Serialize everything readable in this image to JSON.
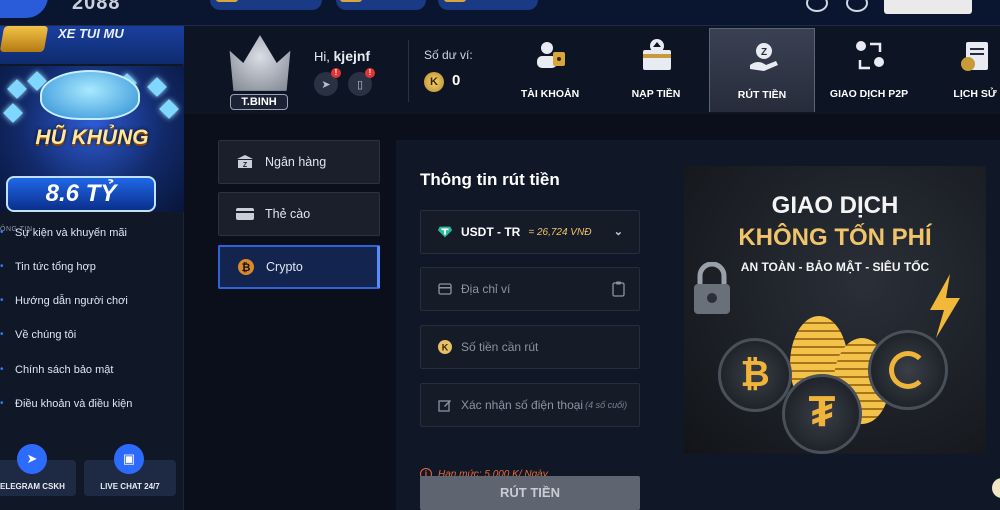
{
  "topbar": {
    "logo": "2088"
  },
  "sidebar": {
    "promo_top": "XE TUI MU",
    "promo_jackpot_title": "HŨ KHỦNG",
    "promo_jackpot_amount": "8.6 TỶ",
    "section_label": "ÔNG TIN",
    "items": [
      {
        "label": "Sự kiện và khuyến mãi"
      },
      {
        "label": "Tin tức tổng hợp"
      },
      {
        "label": "Hướng dẫn người chơi"
      },
      {
        "label": "Về chúng tôi"
      },
      {
        "label": "Chính sách bảo mật"
      },
      {
        "label": "Điều khoản và điều kiện"
      }
    ],
    "support": [
      {
        "label": "TELEGRAM CSKH",
        "icon": "telegram-icon"
      },
      {
        "label": "LIVE CHAT 24/7",
        "icon": "chat-icon"
      }
    ]
  },
  "profile": {
    "rank": "T.BINH",
    "greeting": "Hi,",
    "username": "kjejnf",
    "balance_label": "Số dư ví:",
    "balance_currency": "K",
    "balance_value": "0"
  },
  "nav_tabs": [
    {
      "label": "TÀI KHOẢN",
      "icon": "account-icon",
      "active": false
    },
    {
      "label": "NẠP TIỀN",
      "icon": "deposit-icon",
      "active": false
    },
    {
      "label": "RÚT TIỀN",
      "icon": "withdraw-icon",
      "active": true
    },
    {
      "label": "GIAO DỊCH P2P",
      "icon": "p2p-transfer-icon",
      "active": false
    },
    {
      "label": "LỊCH SỬ",
      "icon": "history-icon",
      "active": false
    }
  ],
  "methods": [
    {
      "label": "Ngân hàng",
      "icon": "bank-icon",
      "active": false
    },
    {
      "label": "Thẻ cào",
      "icon": "card-icon",
      "active": false
    },
    {
      "label": "Crypto",
      "icon": "bitcoin-icon",
      "active": true
    }
  ],
  "form": {
    "title": "Thông tin rút tiền",
    "currency_selected": "USDT - TR",
    "currency_rate": "= 26,724 VNĐ",
    "wallet_placeholder": "Địa chỉ ví",
    "amount_placeholder": "Số tiền cần rút",
    "phone_placeholder": "Xác nhận số điện thoại",
    "phone_hint": "(4 số cuối)",
    "limit_text": "Hạn mức: 5,000 K/ Ngày",
    "submit_label": "RÚT TIỀN"
  },
  "banner": {
    "line1": "GIAO DỊCH",
    "line2": "KHÔNG TỐN PHÍ",
    "line3": "AN TOÀN - BẢO MẬT - SIÊU TỐC"
  },
  "colors": {
    "accent": "#2f63d6",
    "gold": "#f0c46a",
    "warning": "#e86a3a"
  }
}
